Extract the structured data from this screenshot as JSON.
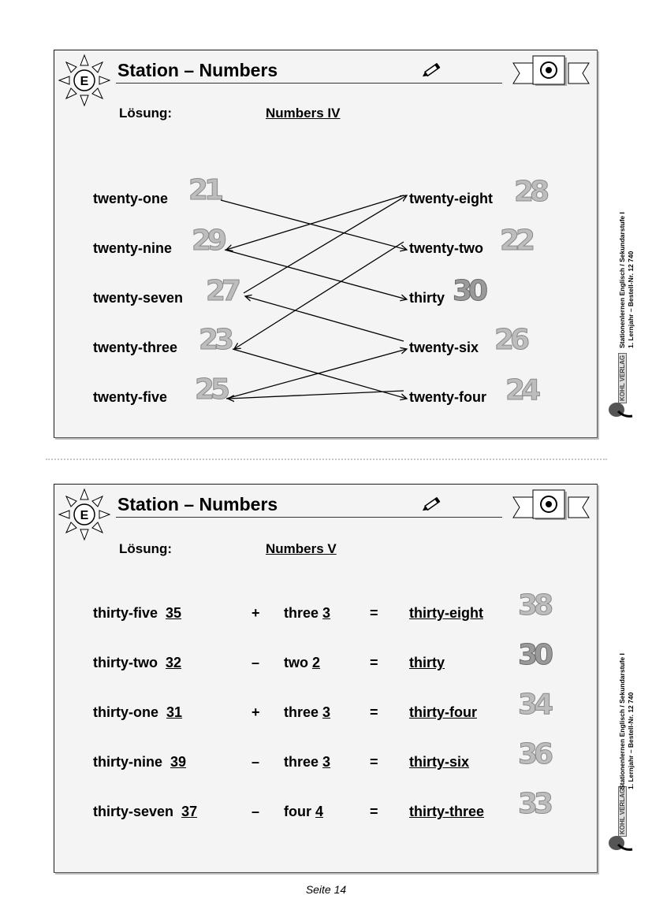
{
  "cards": [
    {
      "badge_letter": "E",
      "title": "Station –  Numbers",
      "solution_label": "Lösung:",
      "subtitle": "Numbers IV",
      "left_items": [
        {
          "word": "twenty-one",
          "numeral": "21"
        },
        {
          "word": "twenty-nine",
          "numeral": "29"
        },
        {
          "word": "twenty-seven",
          "numeral": "27"
        },
        {
          "word": "twenty-three",
          "numeral": "23"
        },
        {
          "word": "twenty-five",
          "numeral": "25"
        }
      ],
      "right_items": [
        {
          "word": "twenty-eight",
          "numeral": "28"
        },
        {
          "word": "twenty-two",
          "numeral": "22"
        },
        {
          "word": "thirty",
          "numeral": "30"
        },
        {
          "word": "twenty-six",
          "numeral": "26"
        },
        {
          "word": "twenty-four",
          "numeral": "24"
        }
      ],
      "connections": [
        {
          "from": "twenty-one",
          "to": "twenty-two"
        },
        {
          "from": "twenty-eight",
          "to": "twenty-nine"
        },
        {
          "from": "twenty-nine",
          "to": "thirty"
        },
        {
          "from": "twenty-seven",
          "to": "twenty-eight"
        },
        {
          "from": "twenty-two",
          "to": "twenty-three"
        },
        {
          "from": "twenty-six",
          "to": "twenty-seven"
        },
        {
          "from": "twenty-three",
          "to": "twenty-four"
        },
        {
          "from": "twenty-five",
          "to": "twenty-six"
        },
        {
          "from": "twenty-four",
          "to": "twenty-five"
        }
      ]
    },
    {
      "badge_letter": "E",
      "title": "Station –  Numbers",
      "solution_label": "Lösung:",
      "subtitle": "Numbers V",
      "equations": [
        {
          "word": "thirty-five",
          "num": "35",
          "op": "+",
          "word2": "three",
          "num2": "3",
          "eq": "=",
          "result": "thirty-eight",
          "numeral": "38"
        },
        {
          "word": "thirty-two",
          "num": "32",
          "op": "–",
          "word2": "two",
          "num2": "2",
          "eq": "=",
          "result": "thirty",
          "numeral": "30"
        },
        {
          "word": "thirty-one",
          "num": "31",
          "op": "+",
          "word2": "three",
          "num2": "3",
          "eq": "=",
          "result": "thirty-four",
          "numeral": "34"
        },
        {
          "word": "thirty-nine",
          "num": "39",
          "op": "–",
          "word2": "three",
          "num2": "3",
          "eq": "=",
          "result": "thirty-six",
          "numeral": "36"
        },
        {
          "word": "thirty-seven",
          "num": "37",
          "op": "–",
          "word2": "four",
          "num2": "4",
          "eq": "=",
          "result": "thirty-three",
          "numeral": "33"
        }
      ]
    }
  ],
  "sidebar": {
    "publisher": "KOHL VERLAG",
    "line1": "Stationenlernen Englisch / Sekundarstufe I",
    "line2": "1. Lernjahr  –  Bestell-Nr. 12 740"
  },
  "footer": "Seite 14"
}
